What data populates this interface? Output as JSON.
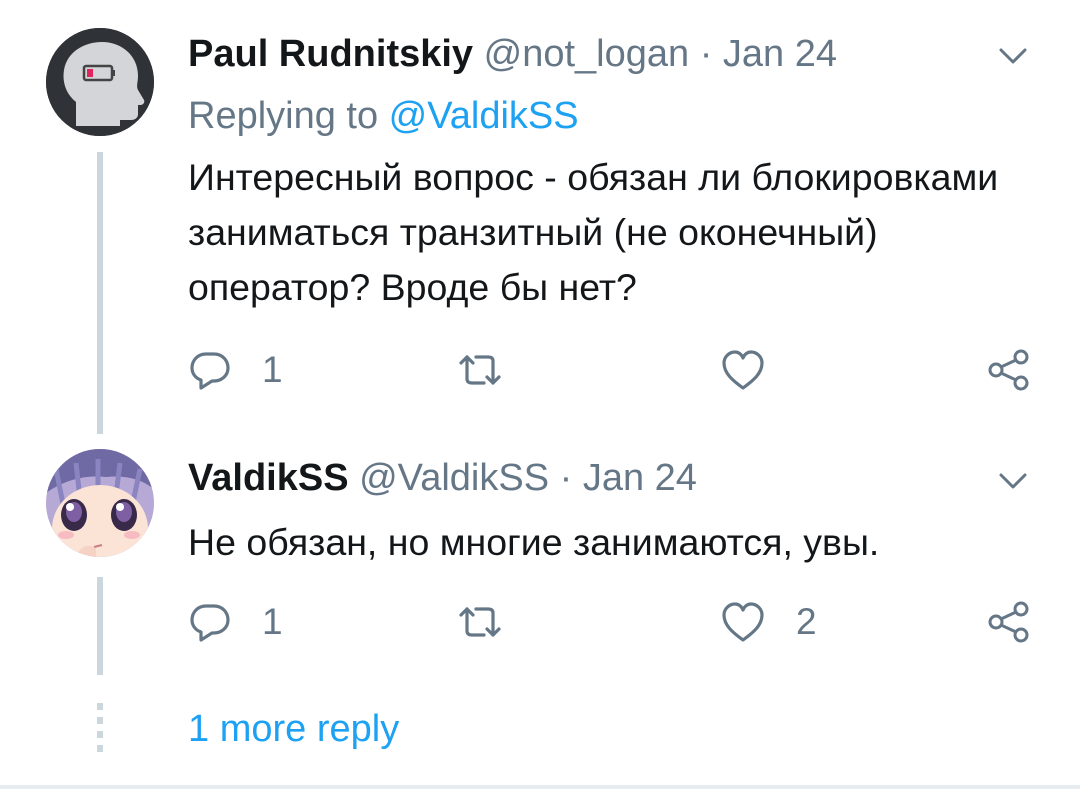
{
  "colors": {
    "text_primary": "#14171a",
    "text_secondary": "#657786",
    "link": "#1da1f2",
    "thread_line": "#ccd6dd",
    "battery_red": "#e0245e"
  },
  "tweets": [
    {
      "name": "Paul Rudnitskiy",
      "handle": "@not_logan",
      "separator": " · ",
      "date": "Jan 24",
      "replying_prefix": "Replying to ",
      "replying_to": "@ValdikSS",
      "text": "Интересный вопрос - обязан ли блокировками заниматься транзитный (не оконечный) оператор? Вроде бы нет?",
      "reply_count": "1",
      "retweet_count": "",
      "like_count": "",
      "icons": {
        "avatar": "head-low-battery-avatar",
        "menu": "chevron-down-icon",
        "reply": "reply-bubble-icon",
        "retweet": "retweet-icon",
        "like": "heart-icon",
        "share": "share-icon"
      }
    },
    {
      "name": "ValdikSS",
      "handle": "@ValdikSS",
      "separator": " · ",
      "date": "Jan 24",
      "text": "Не обязан, но многие занимаются, увы.",
      "reply_count": "1",
      "retweet_count": "",
      "like_count": "2",
      "icons": {
        "avatar": "anime-girl-avatar",
        "menu": "chevron-down-icon",
        "reply": "reply-bubble-icon",
        "retweet": "retweet-icon",
        "like": "heart-icon",
        "share": "share-icon"
      }
    }
  ],
  "more_replies": "1 more reply"
}
